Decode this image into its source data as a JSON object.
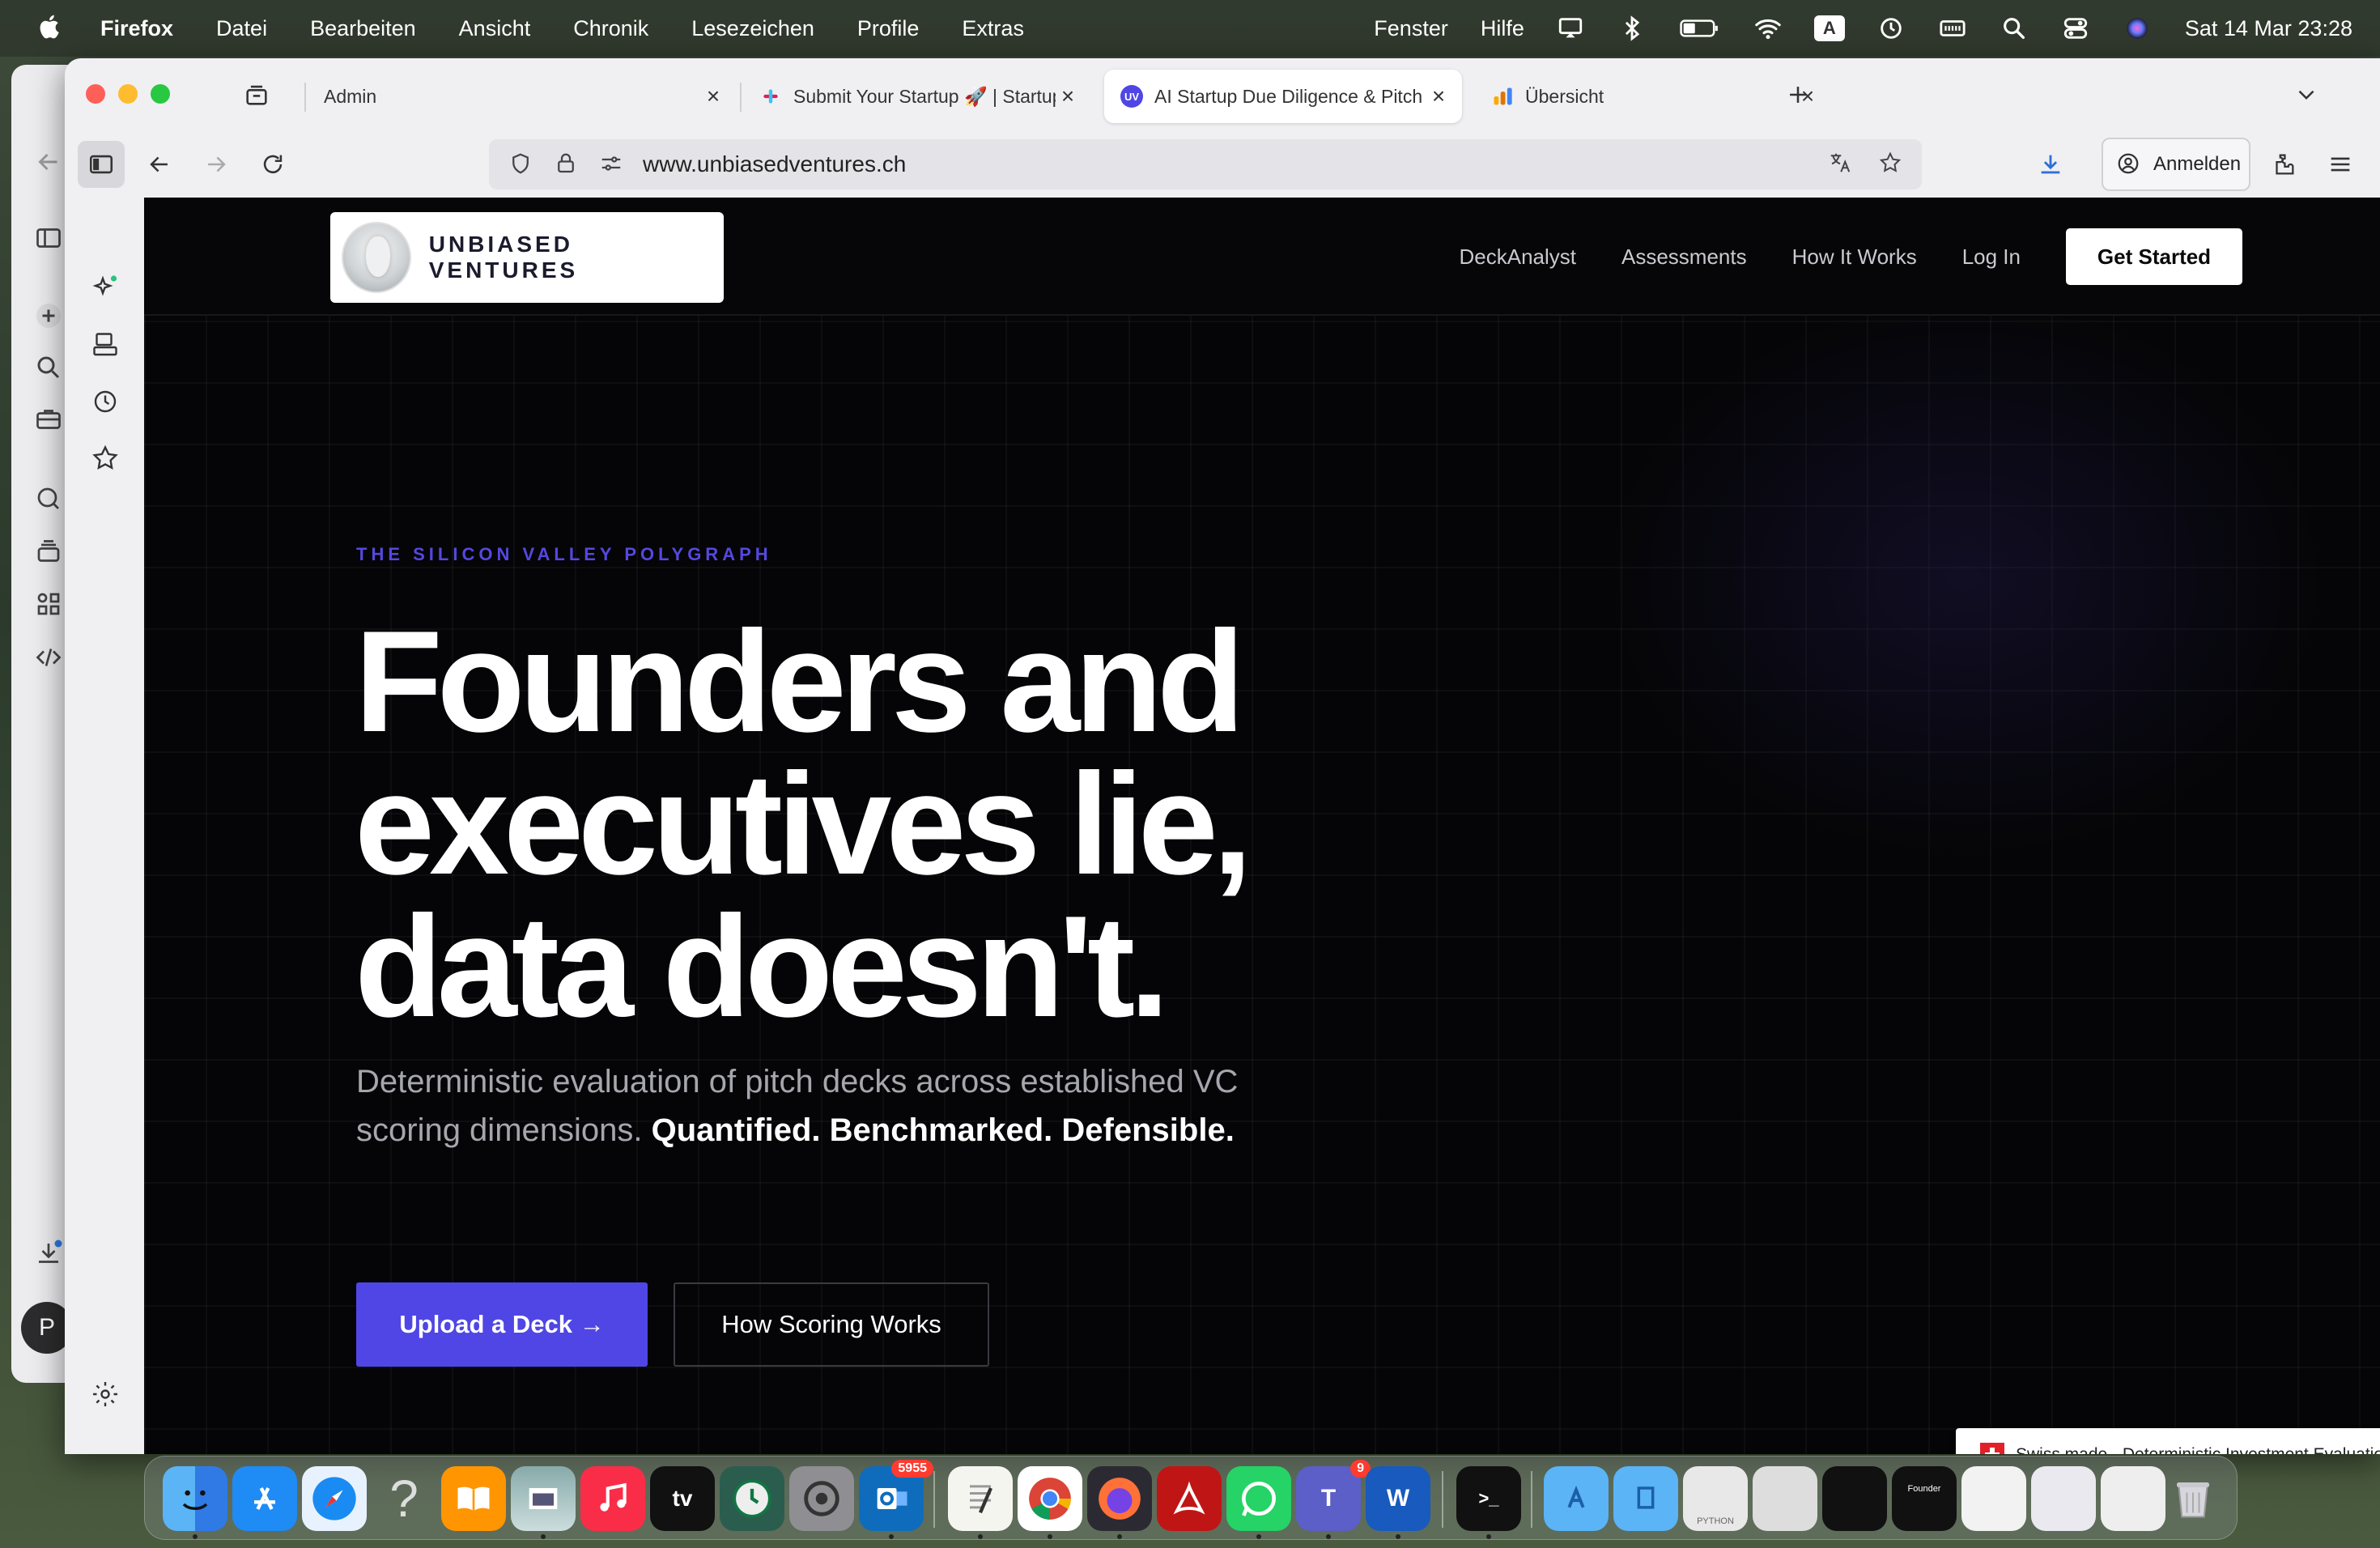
{
  "menubar": {
    "app_name": "Firefox",
    "items": [
      "Datei",
      "Bearbeiten",
      "Ansicht",
      "Chronik",
      "Lesezeichen",
      "Profile",
      "Extras"
    ],
    "right_items": [
      "Fenster",
      "Hilfe"
    ],
    "input_source": "A",
    "datetime": "Sat 14 Mar  23:28"
  },
  "tabs": [
    {
      "label": "Admin",
      "active": false
    },
    {
      "label": "Submit Your Startup 🚀 | Startup",
      "active": false
    },
    {
      "label": "AI Startup Due Diligence & Pitch",
      "active": true,
      "favicon_text": "UV"
    },
    {
      "label": "Übersicht",
      "active": false
    }
  ],
  "toolbar": {
    "url": "www.unbiasedventures.ch",
    "signin_label": "Anmelden"
  },
  "back_window": {
    "avatar_letter": "P"
  },
  "site": {
    "logo_text": "UNBIASED VENTURES",
    "nav": [
      "DeckAnalyst",
      "Assessments",
      "How It Works",
      "Log In"
    ],
    "cta": "Get Started",
    "eyebrow": "THE SILICON VALLEY POLYGRAPH",
    "headline_lines": [
      "Founders and",
      "executives lie,",
      "data doesn't."
    ],
    "subtext_plain": "Deterministic evaluation of pitch decks across established VC scoring dimensions.",
    "subtext_strong": "Quantified. Benchmarked. Defensible.",
    "primary_button": "Upload a Deck →",
    "secondary_button": "How Scoring Works",
    "badge": "Swiss made · Deterministic Investment Evaluation"
  },
  "dock": {
    "outlook_badge": "5955",
    "teams_badge": "9",
    "help_glyph": "?",
    "tv_label": "tv",
    "word_letter": "W",
    "teams_letter": "T",
    "terminal_prompt": ">_",
    "python_label": "PYTHON",
    "founder_label": "Founder"
  },
  "colors": {
    "accent": "#4f46e5",
    "eyebrow": "#5548e0",
    "page_bg": "#050507",
    "swiss_red": "#e3202a"
  }
}
